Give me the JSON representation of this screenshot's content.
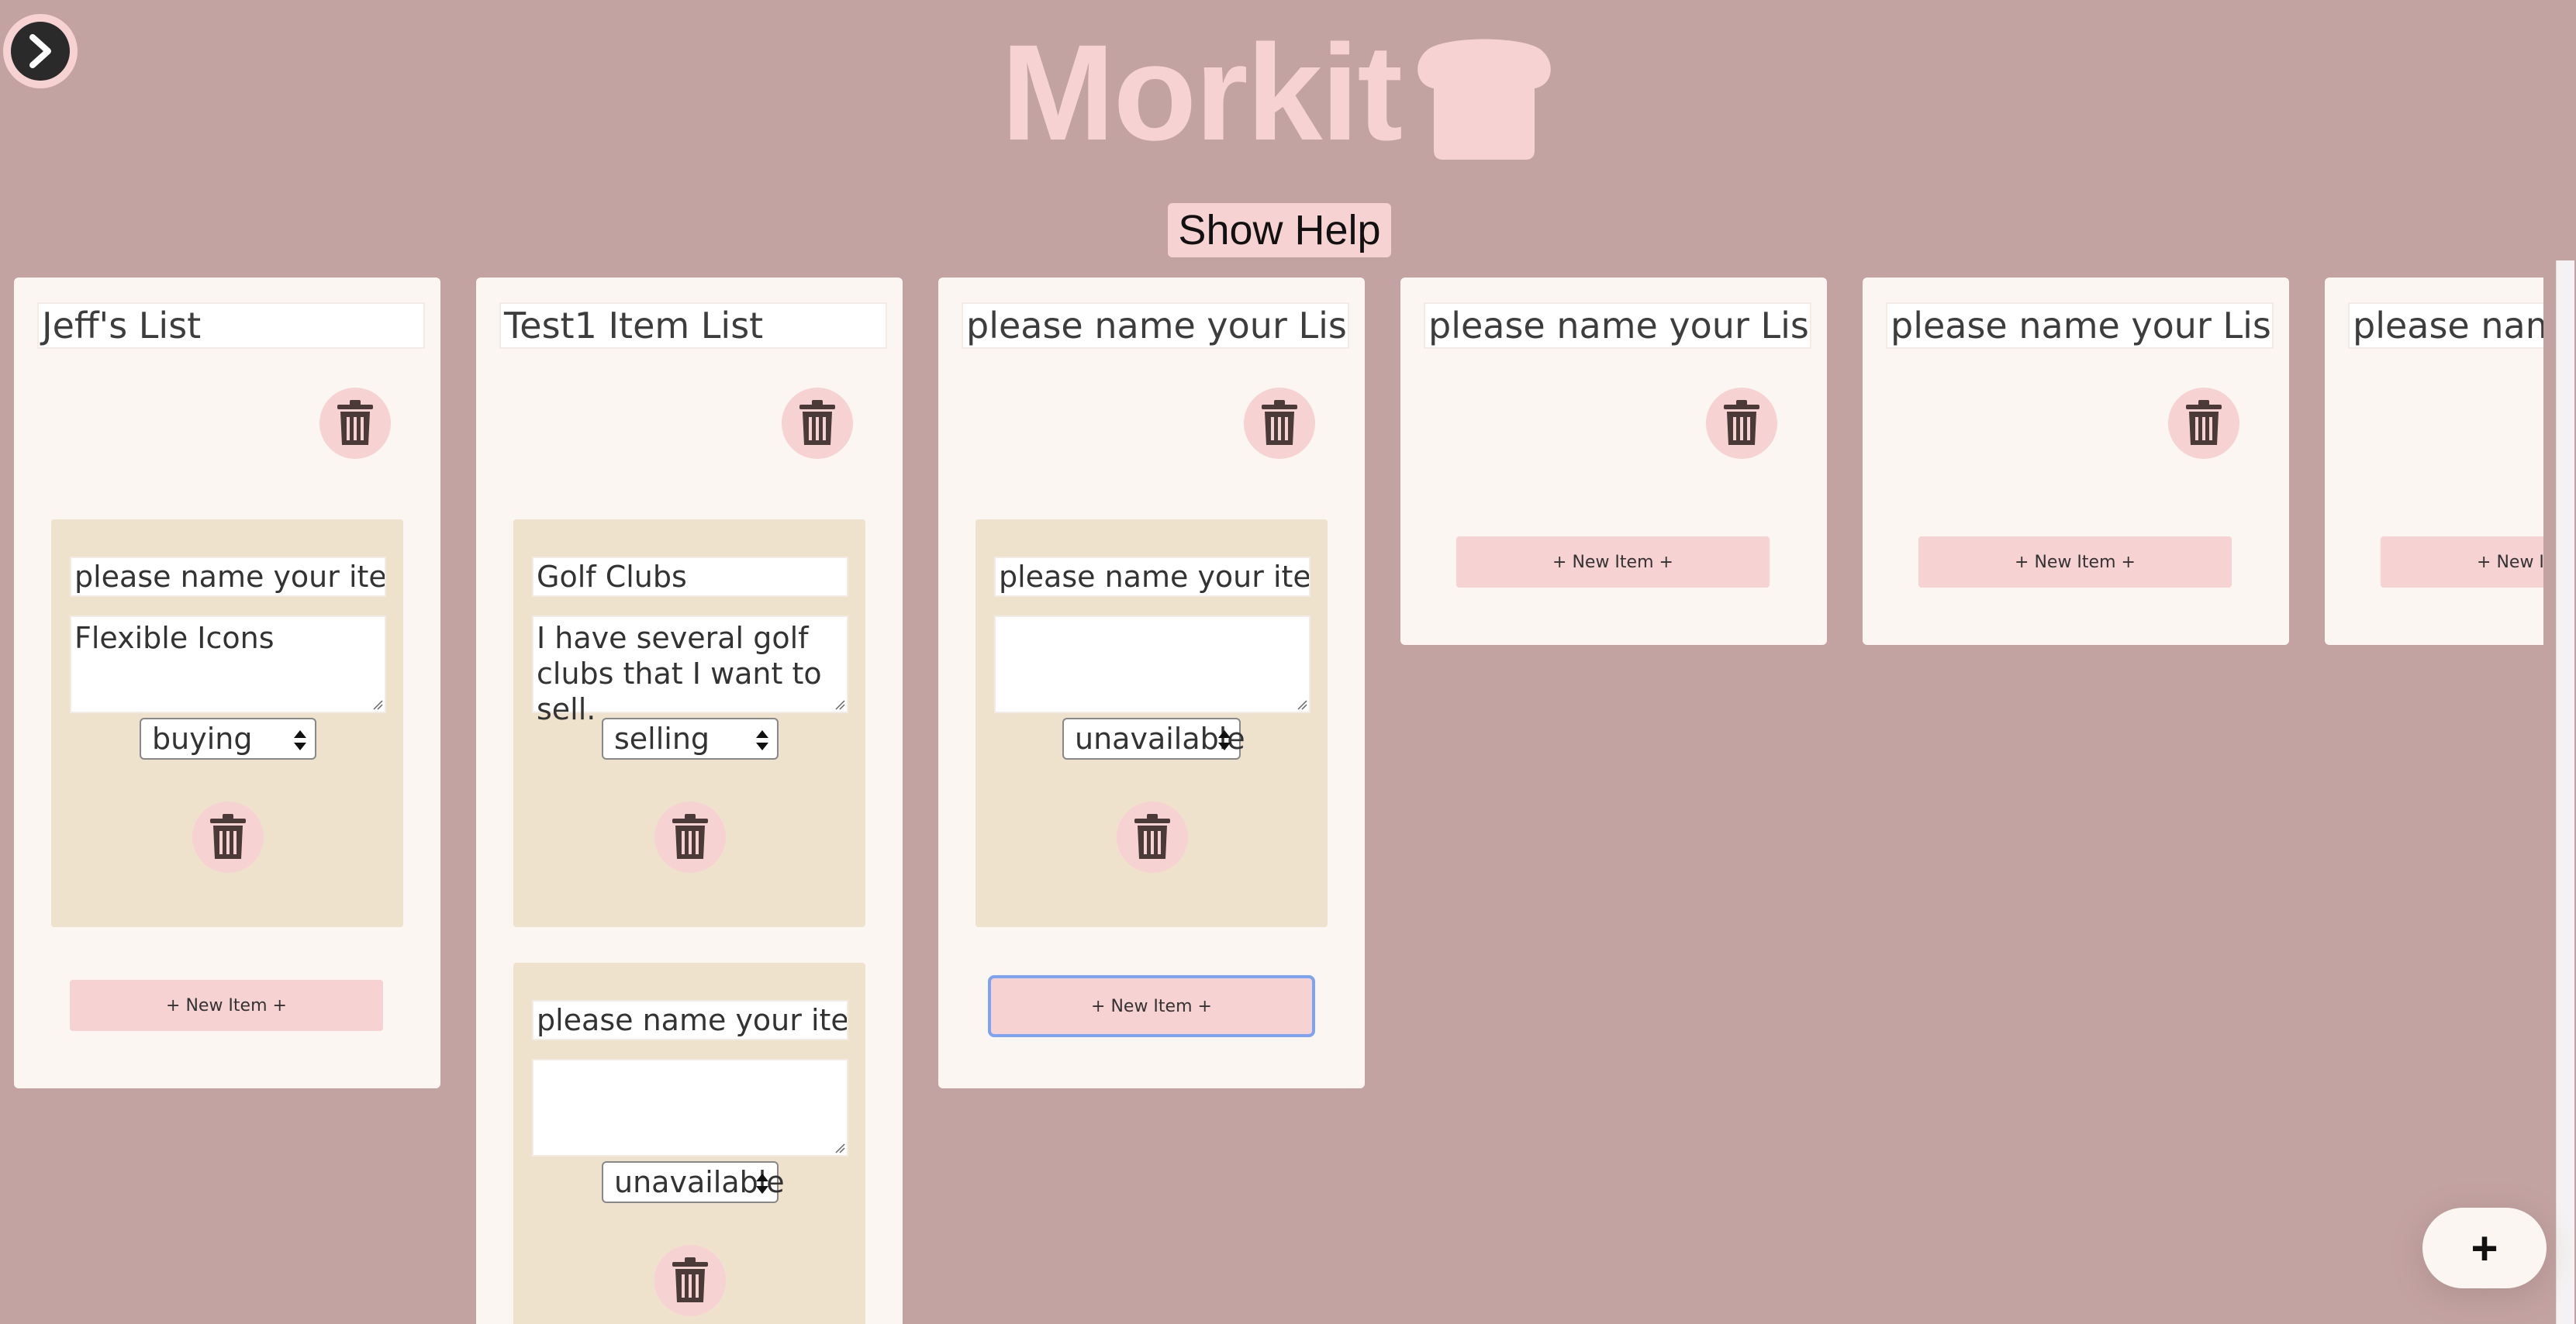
{
  "app": {
    "brand": "Morkit",
    "help_button": "Show Help",
    "fab_label": "+"
  },
  "colors": {
    "background": "#c3a3a1",
    "accent_pink": "#f6d2d2",
    "card_bg": "#fbf6f1",
    "item_bg": "#efe2cc",
    "icon_dark": "#4a3a38"
  },
  "lists": [
    {
      "title": "Jeff's List",
      "new_item_label": "+ New Item +",
      "items": [
        {
          "name": "please name your item",
          "description": "Flexible Icons",
          "status": "buying"
        }
      ]
    },
    {
      "title": "Test1 Item List",
      "new_item_label": "+ New Item +",
      "items": [
        {
          "name": "Golf Clubs",
          "description": "I have several golf clubs that I want to sell.",
          "status": "selling"
        },
        {
          "name": "please name your item",
          "description": "",
          "status": "unavailable"
        }
      ]
    },
    {
      "title": "please name your List",
      "new_item_label": "+ New Item +",
      "items": [
        {
          "name": "please name your item",
          "description": "",
          "status": "unavailable"
        }
      ]
    },
    {
      "title": "please name your List",
      "new_item_label": "+ New Item +",
      "items": []
    },
    {
      "title": "please name your List",
      "new_item_label": "+ New Item +",
      "items": []
    },
    {
      "title": "please name your List",
      "new_item_label": "+ New Item +",
      "items": []
    }
  ],
  "icons": {
    "nav": "chevron-right-icon",
    "brand": "bread-icon",
    "delete": "trash-icon",
    "fab": "plus-icon"
  }
}
